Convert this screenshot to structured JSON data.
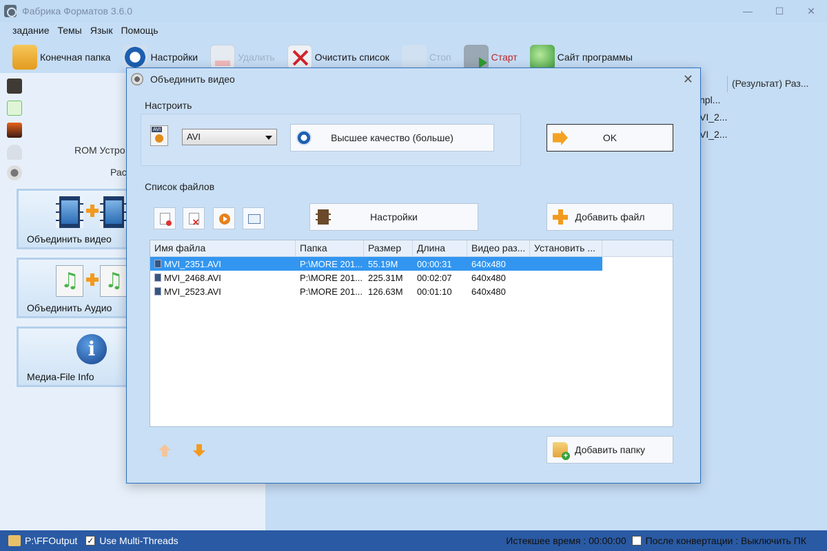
{
  "app": {
    "title": "Фабрика Форматов 3.6.0",
    "window_controls": [
      "—",
      "☐",
      "✕"
    ]
  },
  "menu": [
    "задание",
    "Темы",
    "Язык",
    "Помощь"
  ],
  "toolbar": {
    "output_folder": "Конечная папка",
    "settings": "Настройки",
    "delete": "Удалить",
    "clear_list": "Очистить список",
    "stop": "Стоп",
    "start": "Старт",
    "website": "Сайт программы"
  },
  "sidebar": {
    "rom_label": "ROM Устро",
    "misc_label": "Рас",
    "cards": {
      "join_video": "Объединить видео",
      "join_audio": "Объединить Аудио",
      "media_info": "Медиа-File Info"
    }
  },
  "background_list": {
    "header": "(Результат) Раз...",
    "rows": [
      "npl...",
      "VI_2...",
      "VI_2..."
    ]
  },
  "statusbar": {
    "output_path": "P:\\FFOutput",
    "multithreads_label": "Use Multi-Threads",
    "multithreads_checked": true,
    "elapsed": "Истекшее время : 00:00:00",
    "after_convert": "После конвертации : Выключить ПК",
    "after_convert_checked": false
  },
  "dialog": {
    "title": "Объединить видео",
    "close": "✕",
    "configure_label": "Настроить",
    "format_value": "AVI",
    "quality_button": "Высшее качество (больше)",
    "ok_button": "OK",
    "file_list_label": "Список файлов",
    "settings_button": "Настройки",
    "add_file_button": "Добавить файл",
    "add_folder_button": "Добавить папку",
    "table": {
      "headers": [
        "Имя файла",
        "Папка",
        "Размер",
        "Длина",
        "Видео раз...",
        "Установить ..."
      ],
      "rows": [
        {
          "name": "MVI_2351.AVI",
          "folder": "P:\\MORE 201...",
          "size": "55.19M",
          "length": "00:00:31",
          "video": "640x480",
          "set": ""
        },
        {
          "name": "MVI_2468.AVI",
          "folder": "P:\\MORE 201...",
          "size": "225.31M",
          "length": "00:02:07",
          "video": "640x480",
          "set": ""
        },
        {
          "name": "MVI_2523.AVI",
          "folder": "P:\\MORE 201...",
          "size": "126.63M",
          "length": "00:01:10",
          "video": "640x480",
          "set": ""
        }
      ]
    }
  }
}
